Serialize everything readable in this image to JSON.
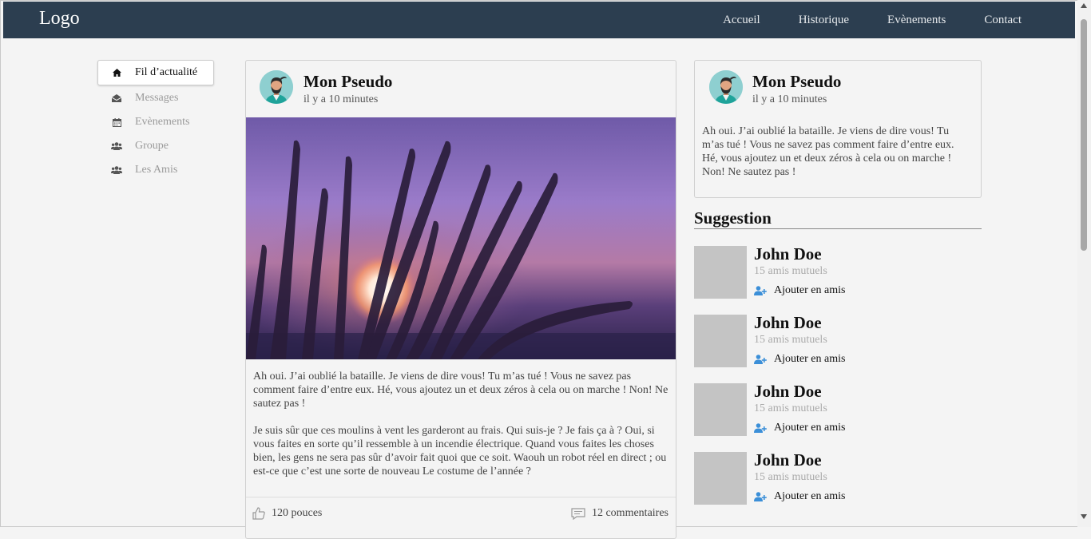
{
  "header": {
    "logo": "Logo",
    "nav": [
      "Accueil",
      "Historique",
      "Evènements",
      "Contact"
    ]
  },
  "sidebar": {
    "items": [
      {
        "label": "Fil d’actualité",
        "icon": "home-icon",
        "active": true
      },
      {
        "label": "Messages",
        "icon": "envelope-icon",
        "active": false
      },
      {
        "label": "Evènements",
        "icon": "calendar-icon",
        "active": false
      },
      {
        "label": "Groupe",
        "icon": "users-icon",
        "active": false
      },
      {
        "label": "Les Amis",
        "icon": "users-icon",
        "active": false
      }
    ]
  },
  "post": {
    "author": "Mon Pseudo",
    "time": "il y a 10 minutes",
    "paragraphs": [
      "Ah oui. J’ai oublié la bataille. Je viens de dire vous! Tu m’as tué ! Vous ne savez pas comment faire d’entre eux. Hé, vous ajoutez un et deux zéros à cela ou on marche ! Non! Ne sautez pas !",
      "Je suis sûr que ces moulins à vent les garderont au frais. Qui suis-je ? Je fais ça à ? Oui, si vous faites en sorte qu’il ressemble à un incendie électrique. Quand vous faites les choses bien, les gens ne sera pas sûr d’avoir fait quoi que ce soit. Waouh un robot réel en direct ; ou est-ce que c’est une sorte de nouveau Le costume de l’année ?"
    ],
    "likes": "120 pouces",
    "comments": "12 commentaires"
  },
  "side_post": {
    "author": "Mon Pseudo",
    "time": "il y a 10 minutes",
    "text": "Ah oui. J’ai oublié la bataille. Je viens de dire vous! Tu m’as tué ! Vous ne savez pas comment faire d’entre eux. Hé, vous ajoutez un et deux zéros à cela ou on marche ! Non! Ne sautez pas !"
  },
  "suggestions": {
    "title": "Suggestion",
    "items": [
      {
        "name": "John Doe",
        "mutual": "15 amis mutuels",
        "action": "Ajouter en amis"
      },
      {
        "name": "John Doe",
        "mutual": "15 amis mutuels",
        "action": "Ajouter en amis"
      },
      {
        "name": "John Doe",
        "mutual": "15 amis mutuels",
        "action": "Ajouter en amis"
      },
      {
        "name": "John Doe",
        "mutual": "15 amis mutuels",
        "action": "Ajouter en amis"
      }
    ]
  },
  "colors": {
    "header_bg": "#2c3e50",
    "page_bg": "#f4f4f4",
    "add_friend_icon": "#3b8fd8"
  }
}
